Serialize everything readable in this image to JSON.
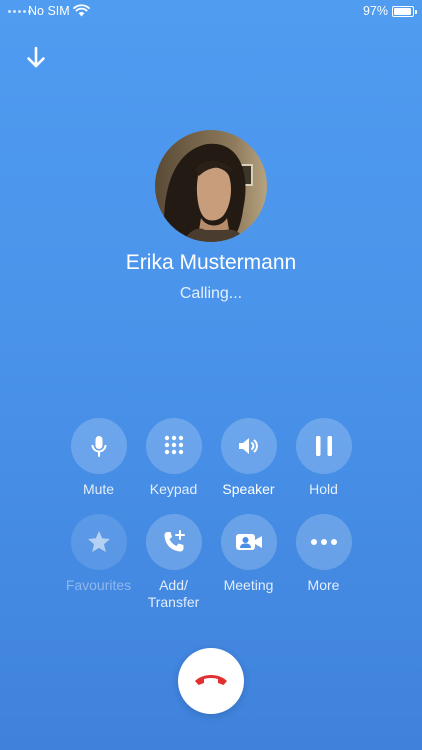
{
  "status_bar": {
    "carrier": "No SIM",
    "battery_percent": "97%",
    "battery_level": 0.97
  },
  "call": {
    "contact_name": "Erika Mustermann",
    "status": "Calling..."
  },
  "controls": [
    {
      "label": "Mute",
      "icon": "microphone-icon"
    },
    {
      "label": "Keypad",
      "icon": "keypad-icon"
    },
    {
      "label": "Speaker",
      "icon": "speaker-icon",
      "state": "active"
    },
    {
      "label": "Hold",
      "icon": "pause-icon"
    },
    {
      "label": "Favourites",
      "icon": "star-icon",
      "state": "disabled"
    },
    {
      "label": "Add/ Transfer",
      "icon": "add-call-icon"
    },
    {
      "label": "Meeting",
      "icon": "video-camera-icon"
    },
    {
      "label": "More",
      "icon": "more-icon"
    }
  ],
  "colors": {
    "background_top": "#4f9cf1",
    "background_bottom": "#3f82dc",
    "hangup_icon": "#e0302f"
  }
}
